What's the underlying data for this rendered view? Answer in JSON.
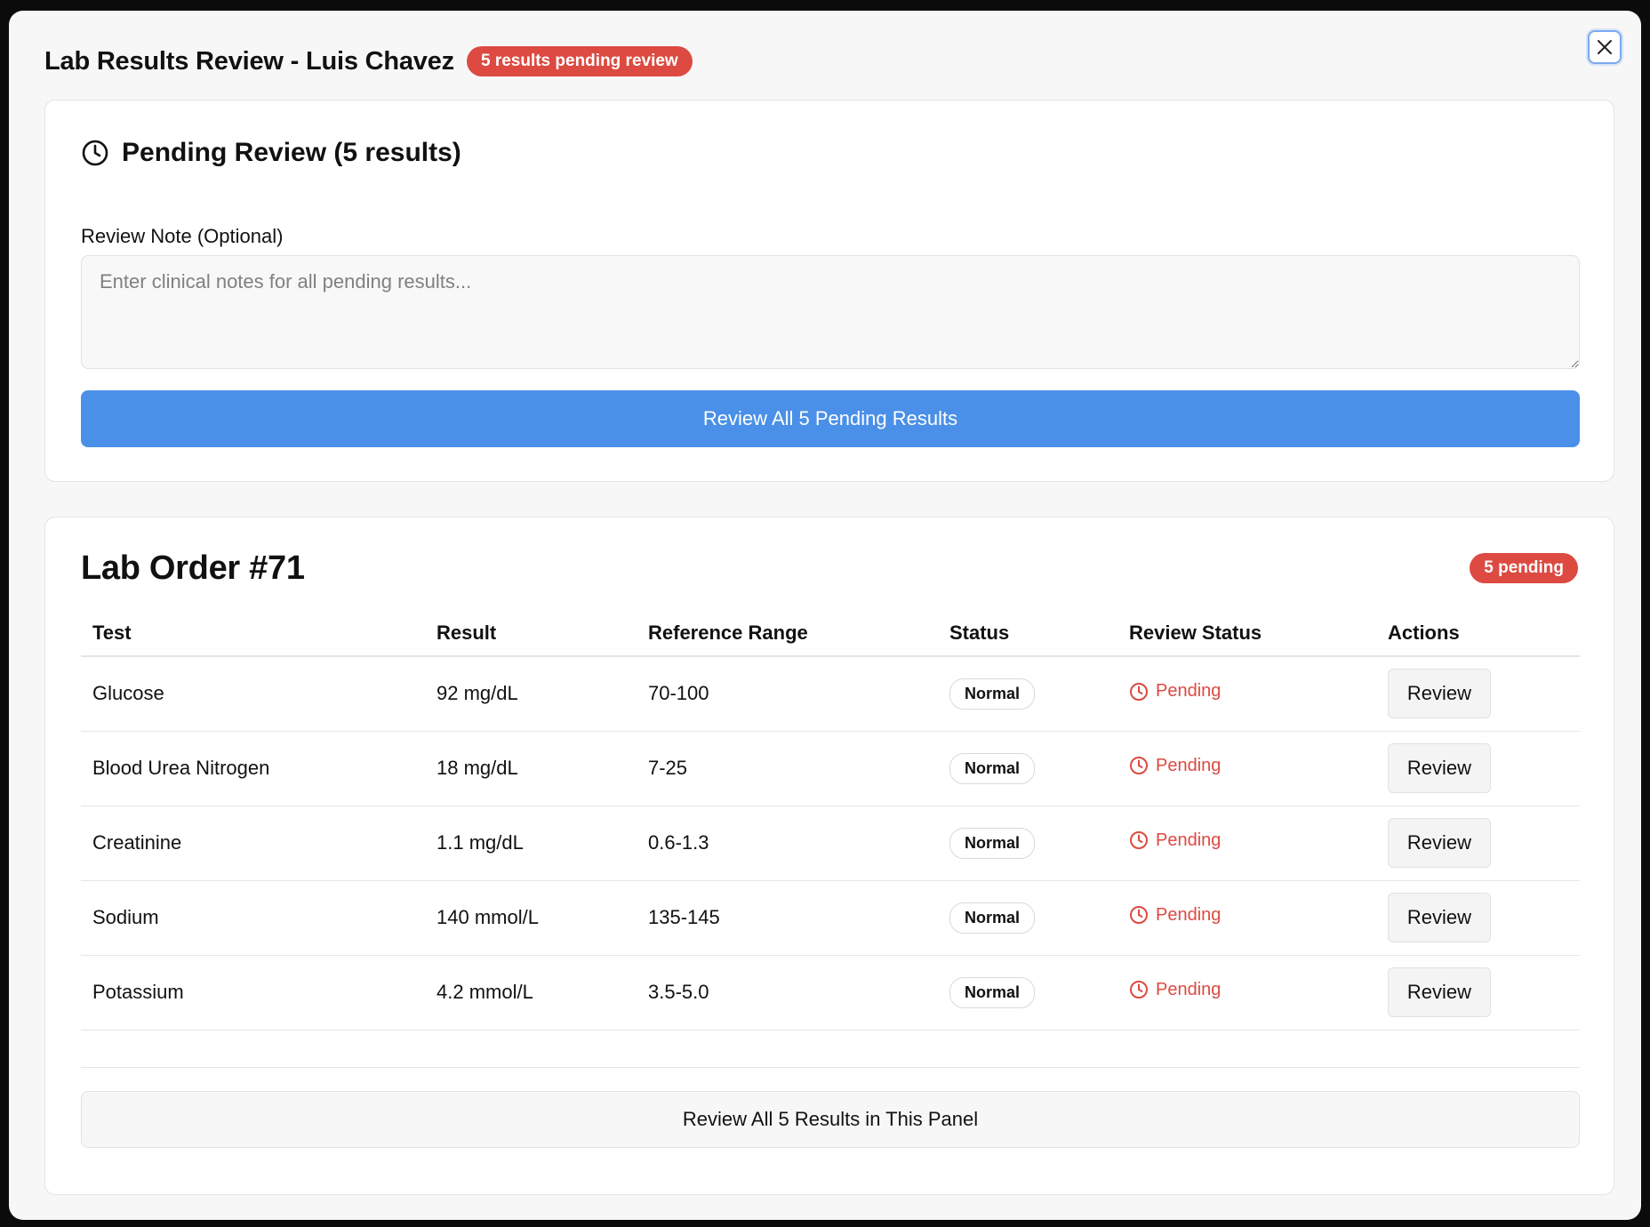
{
  "modal": {
    "title": "Lab Results Review - Luis Chavez",
    "pending_badge": "5 results pending review",
    "close_icon": "close-icon"
  },
  "pending_section": {
    "heading": "Pending Review (5 results)",
    "heading_icon": "clock-icon",
    "note_label": "Review Note (Optional)",
    "note_value": "",
    "note_placeholder": "Enter clinical notes for all pending results...",
    "review_all_button": "Review All 5 Pending Results"
  },
  "lab_order": {
    "title": "Lab Order #71",
    "badge": "5 pending",
    "columns": [
      "Test",
      "Result",
      "Reference Range",
      "Status",
      "Review Status",
      "Actions"
    ],
    "rows": [
      {
        "test": "Glucose",
        "result": "92 mg/dL",
        "range": "70-100",
        "status": "Normal",
        "review_status": "Pending",
        "action": "Review"
      },
      {
        "test": "Blood Urea Nitrogen",
        "result": "18 mg/dL",
        "range": "7-25",
        "status": "Normal",
        "review_status": "Pending",
        "action": "Review"
      },
      {
        "test": "Creatinine",
        "result": "1.1 mg/dL",
        "range": "0.6-1.3",
        "status": "Normal",
        "review_status": "Pending",
        "action": "Review"
      },
      {
        "test": "Sodium",
        "result": "140 mmol/L",
        "range": "135-145",
        "status": "Normal",
        "review_status": "Pending",
        "action": "Review"
      },
      {
        "test": "Potassium",
        "result": "4.2 mmol/L",
        "range": "3.5-5.0",
        "status": "Normal",
        "review_status": "Pending",
        "action": "Review"
      }
    ],
    "panel_button": "Review All 5 Results in This Panel"
  },
  "colors": {
    "accent_blue": "#4a90e8",
    "pending_red": "#dc4a41"
  }
}
